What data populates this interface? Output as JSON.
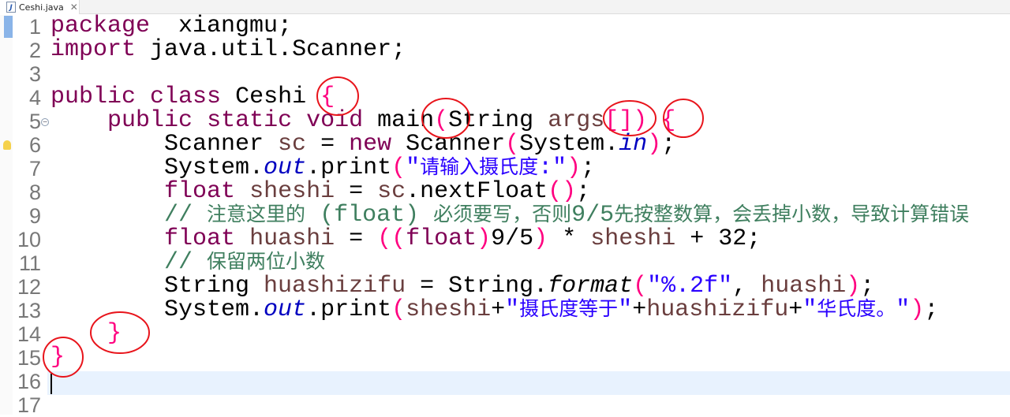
{
  "tab": {
    "title": "Ceshi.java",
    "icon": "java-file-icon",
    "close": "✕"
  },
  "editor": {
    "current_line": 16,
    "line_numbers": [
      "1",
      "2",
      "3",
      "4",
      "5",
      "6",
      "7",
      "8",
      "9",
      "10",
      "11",
      "12",
      "13",
      "14",
      "15",
      "16",
      "17"
    ],
    "lines": [
      [
        [
          "kw",
          "package"
        ],
        [
          "",
          "  xiangmu;"
        ]
      ],
      [
        [
          "kw",
          "import"
        ],
        [
          "",
          " java.util.Scanner;"
        ]
      ],
      [],
      [
        [
          "kw",
          "public"
        ],
        [
          "",
          " "
        ],
        [
          "kw",
          "class"
        ],
        [
          "",
          " Ceshi "
        ],
        [
          "br",
          "{"
        ]
      ],
      [
        [
          "",
          "    "
        ],
        [
          "kw",
          "public"
        ],
        [
          "",
          " "
        ],
        [
          "kw",
          "static"
        ],
        [
          "",
          " "
        ],
        [
          "kw",
          "void"
        ],
        [
          "",
          " main"
        ],
        [
          "br",
          "("
        ],
        [
          "",
          "String "
        ],
        [
          "var",
          "args"
        ],
        [
          "br",
          "[])"
        ],
        [
          "",
          " "
        ],
        [
          "br",
          "{"
        ]
      ],
      [
        [
          "",
          "        Scanner "
        ],
        [
          "var",
          "sc"
        ],
        [
          "",
          " = "
        ],
        [
          "kw",
          "new"
        ],
        [
          "",
          " Scanner"
        ],
        [
          "br",
          "("
        ],
        [
          "",
          "System."
        ],
        [
          "fld",
          "in"
        ],
        [
          "br",
          ")"
        ],
        [
          "",
          ";"
        ]
      ],
      [
        [
          "",
          "        System."
        ],
        [
          "fld",
          "out"
        ],
        [
          "",
          ".print"
        ],
        [
          "br",
          "("
        ],
        [
          "str",
          "\"请输入摄氏度:\""
        ],
        [
          "br",
          ")"
        ],
        [
          "",
          ";"
        ]
      ],
      [
        [
          "",
          "        "
        ],
        [
          "kw",
          "float"
        ],
        [
          "",
          " "
        ],
        [
          "var",
          "sheshi"
        ],
        [
          "",
          " = "
        ],
        [
          "var",
          "sc"
        ],
        [
          "",
          ".nextFloat"
        ],
        [
          "br",
          "()"
        ],
        [
          "",
          ";"
        ]
      ],
      [
        [
          "",
          "        "
        ],
        [
          "cm",
          "// 注意这里的 (float) 必须要写，否则9/5先按整数算，会丢掉小数，导致计算错误"
        ]
      ],
      [
        [
          "",
          "        "
        ],
        [
          "kw",
          "float"
        ],
        [
          "",
          " "
        ],
        [
          "var",
          "huashi"
        ],
        [
          "",
          " = "
        ],
        [
          "br",
          "(("
        ],
        [
          "kw",
          "float"
        ],
        [
          "br",
          ")"
        ],
        [
          "",
          "9/5"
        ],
        [
          "br",
          ")"
        ],
        [
          "",
          " * "
        ],
        [
          "var",
          "sheshi"
        ],
        [
          "",
          " + 32;"
        ]
      ],
      [
        [
          "",
          "        "
        ],
        [
          "cm",
          "// 保留两位小数"
        ]
      ],
      [
        [
          "",
          "        String "
        ],
        [
          "var",
          "huashizifu"
        ],
        [
          "",
          " = String."
        ],
        [
          "it",
          "format"
        ],
        [
          "br",
          "("
        ],
        [
          "str",
          "\"%.2f\""
        ],
        [
          "",
          ", "
        ],
        [
          "var",
          "huashi"
        ],
        [
          "br",
          ")"
        ],
        [
          "",
          ";"
        ]
      ],
      [
        [
          "",
          "        System."
        ],
        [
          "fld",
          "out"
        ],
        [
          "",
          ".print"
        ],
        [
          "br",
          "("
        ],
        [
          "var",
          "sheshi"
        ],
        [
          "",
          "+"
        ],
        [
          "str",
          "\"摄氏度等于\""
        ],
        [
          "",
          "+"
        ],
        [
          "var",
          "huashizifu"
        ],
        [
          "",
          "+"
        ],
        [
          "str",
          "\"华氏度。\""
        ],
        [
          "br",
          ")"
        ],
        [
          "",
          ";"
        ]
      ],
      [
        [
          "",
          "    "
        ],
        [
          "br",
          "}"
        ]
      ],
      [
        [
          "br",
          "}"
        ]
      ],
      [],
      []
    ]
  },
  "colors": {
    "keyword": "#7f0055",
    "variable": "#6a3e3e",
    "comment": "#3f7f5f",
    "string": "#2a00ff",
    "field": "#0000c0",
    "bracket": "#ff0080",
    "annotation": "#e8141b",
    "current_line": "#e8f2fe"
  }
}
